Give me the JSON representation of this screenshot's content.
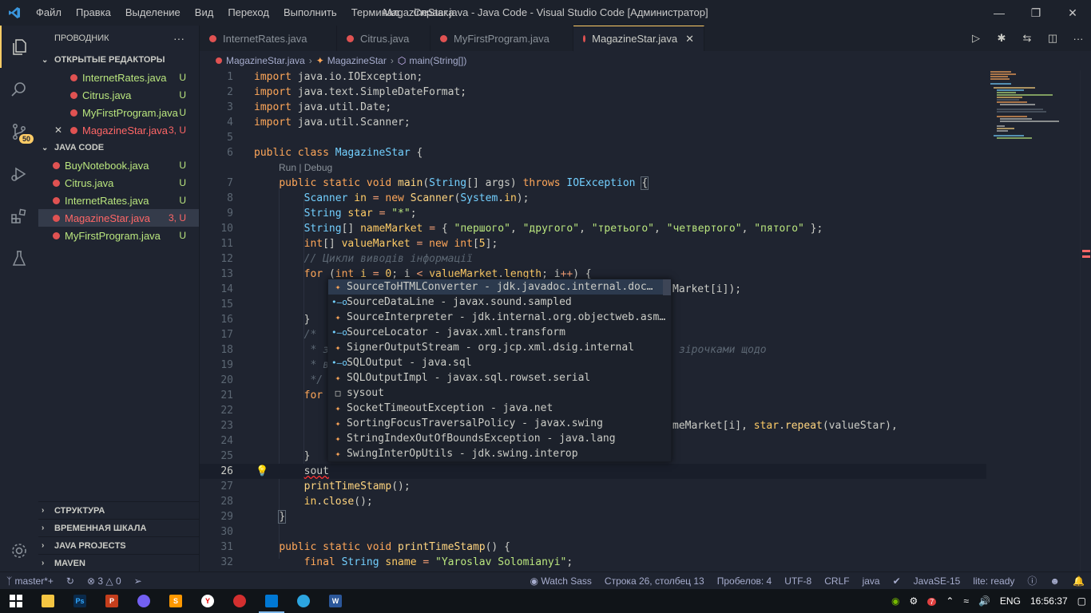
{
  "titlebar": {
    "menu": [
      "Файл",
      "Правка",
      "Выделение",
      "Вид",
      "Переход",
      "Выполнить",
      "Терминал",
      "Справка"
    ],
    "title": "MagazineStar.java - Java Code - Visual Studio Code [Администратор]"
  },
  "activity": {
    "scm_badge": "50"
  },
  "sidebar": {
    "title": "ПРОВОДНИК",
    "more": "···",
    "open_editors_title": "ОТКРЫТЫЕ РЕДАКТОРЫ",
    "open_editors": [
      {
        "name": "InternetRates.java",
        "status": "U"
      },
      {
        "name": "Citrus.java",
        "status": "U"
      },
      {
        "name": "MyFirstProgram.java",
        "status": "U"
      },
      {
        "name": "MagazineStar.java",
        "status": "3, U"
      }
    ],
    "folder_title": "JAVA CODE",
    "files": [
      {
        "name": "BuyNotebook.java",
        "status": "U"
      },
      {
        "name": "Citrus.java",
        "status": "U"
      },
      {
        "name": "InternetRates.java",
        "status": "U"
      },
      {
        "name": "MagazineStar.java",
        "status": "3, U"
      },
      {
        "name": "MyFirstProgram.java",
        "status": "U"
      }
    ],
    "bottom_sections": [
      "СТРУКТУРА",
      "ВРЕМЕННАЯ ШКАЛА",
      "JAVA PROJECTS",
      "MAVEN"
    ]
  },
  "tabs": [
    "InternetRates.java",
    "Citrus.java",
    "MyFirstProgram.java",
    "MagazineStar.java"
  ],
  "breadcrumb": [
    "MagazineStar.java",
    "MagazineStar",
    "main(String[])"
  ],
  "editor": {
    "line_numbers": [
      "1",
      "2",
      "3",
      "4",
      "5",
      "6",
      "",
      "7",
      "8",
      "9",
      "10",
      "11",
      "12",
      "13",
      "14",
      "15",
      "16",
      "17",
      "18",
      "19",
      "20",
      "21",
      "22",
      "23",
      "24",
      "25",
      "26",
      "27",
      "28",
      "29",
      "30",
      "31",
      "32"
    ],
    "codelens": "Run | Debug",
    "line_14_tail": "Market[i]);",
    "line_18_tail": "зірочками щодо",
    "line_23_tail_a": "meMarket[i], ",
    "line_23_tail_b": "star",
    "line_23_tail_c": ".",
    "line_23_tail_d": "repeat",
    "line_23_tail_e": "(valueStar),"
  },
  "suggest": [
    {
      "kind": "class",
      "text": "SourceToHTMLConverter - jdk.javadoc.internal.doc…"
    },
    {
      "kind": "interface",
      "text": "SourceDataLine - javax.sound.sampled"
    },
    {
      "kind": "class",
      "text": "SourceInterpreter - jdk.internal.org.objectweb.asm…"
    },
    {
      "kind": "interface",
      "text": "SourceLocator - javax.xml.transform"
    },
    {
      "kind": "class",
      "text": "SignerOutputStream - org.jcp.xml.dsig.internal"
    },
    {
      "kind": "interface",
      "text": "SQLOutput - java.sql"
    },
    {
      "kind": "class",
      "text": "SQLOutputImpl - javax.sql.rowset.serial"
    },
    {
      "kind": "snippet",
      "text": "sysout"
    },
    {
      "kind": "class",
      "text": "SocketTimeoutException - java.net"
    },
    {
      "kind": "class",
      "text": "SortingFocusTraversalPolicy - javax.swing"
    },
    {
      "kind": "class",
      "text": "StringIndexOutOfBoundsException - java.lang"
    },
    {
      "kind": "class",
      "text": "SwingInterOpUtils - jdk.swing.interop"
    }
  ],
  "statusbar": {
    "branch": "master*+",
    "errors": "3",
    "warnings": "0",
    "watch_sass": "Watch Sass",
    "position": "Строка 26, столбец 13",
    "spaces": "Пробелов: 4",
    "encoding": "UTF-8",
    "eol": "CRLF",
    "language": "java",
    "jdk": "JavaSE-15",
    "lite": "lite: ready"
  },
  "taskbar": {
    "lang": "ENG",
    "time": "16:56:37",
    "tray_badge": "7"
  },
  "colors": {
    "accent": "#ffcc66",
    "error": "#ff6666",
    "untracked": "#bae67e",
    "background": "#1f2430"
  }
}
